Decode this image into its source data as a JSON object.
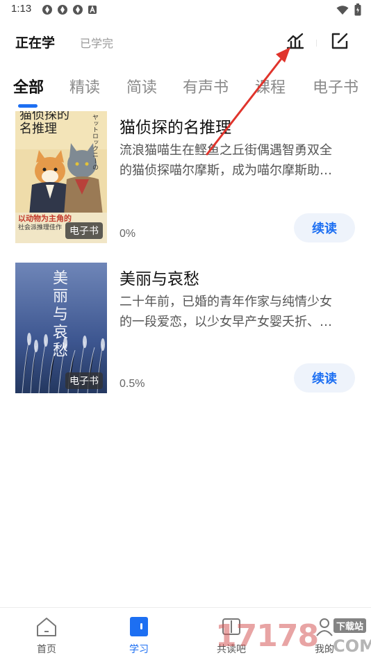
{
  "status_bar": {
    "time": "1:13",
    "notification_icons": [
      "app-icon",
      "app-icon",
      "app-icon",
      "a-icon"
    ],
    "wifi_icon": "wifi-icon",
    "battery_icon": "battery-icon"
  },
  "header": {
    "tabs": [
      {
        "label": "正在学",
        "active": true
      },
      {
        "label": "已学完",
        "active": false
      }
    ],
    "stats_icon": "stats-chart-icon",
    "edit_icon": "edit-icon"
  },
  "categories": [
    {
      "label": "全部",
      "active": true
    },
    {
      "label": "精读",
      "active": false
    },
    {
      "label": "简读",
      "active": false
    },
    {
      "label": "有声书",
      "active": false
    },
    {
      "label": "课程",
      "active": false
    },
    {
      "label": "电子书",
      "active": false
    }
  ],
  "books": [
    {
      "title": "猫侦探的名推理",
      "desc_line1": "流浪猫喵生在鲣鱼之丘街偶遇智勇双全",
      "desc_line2": "的猫侦探喵尔摩斯，成为喵尔摩斯助…",
      "progress": "0%",
      "badge": "电子书",
      "button": "续读",
      "cover_title_line1": "猫侦探的",
      "cover_title_line2": "名推理",
      "cover_tagline": "以动物为主角的",
      "cover_sub": "社会派推理佳作",
      "cover_vertical": "ヤットロックニーの"
    },
    {
      "title": "美丽与哀愁",
      "desc_line1": "二十年前，已婚的青年作家与纯情少女",
      "desc_line2": "的一段爱恋，以少女早产女婴夭折、…",
      "progress": "0.5%",
      "badge": "电子书",
      "button": "续读",
      "cover_title": "美丽与哀愁"
    }
  ],
  "bottom_nav": [
    {
      "label": "首页",
      "icon": "home-icon",
      "active": false
    },
    {
      "label": "学习",
      "icon": "study-icon",
      "active": true
    },
    {
      "label": "共读吧",
      "icon": "read-together-icon",
      "active": false
    },
    {
      "label": "我的",
      "icon": "profile-icon",
      "active": false
    }
  ],
  "watermark": {
    "text": "17178",
    "sub": "下载站",
    "domain": ".COM"
  },
  "colors": {
    "accent": "#1d6ff2",
    "annotation_arrow": "#e0342c"
  }
}
